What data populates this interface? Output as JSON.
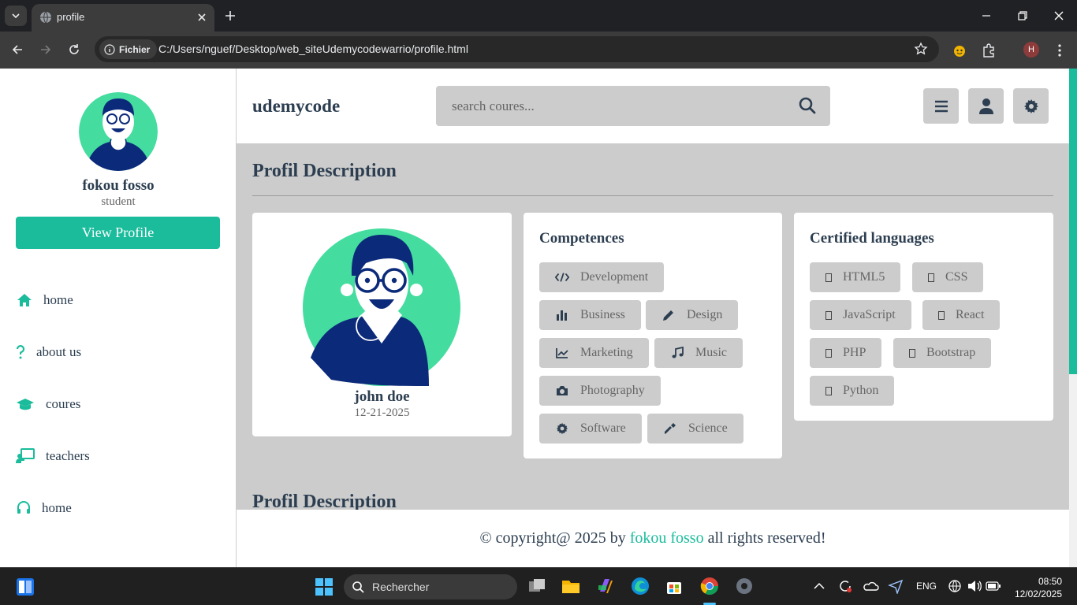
{
  "browser": {
    "tab_title": "profile",
    "security_chip": "Fichier",
    "url": "C:/Users/nguef/Desktop/web_siteUdemycodewarrio/profile.html",
    "profile_initial": "H"
  },
  "sidebar": {
    "user_name": "fokou fosso",
    "user_role": "student",
    "view_profile_label": "View Profile",
    "nav": [
      {
        "label": "home",
        "icon": "home-icon"
      },
      {
        "label": "about us",
        "icon": "question-icon"
      },
      {
        "label": "coures",
        "icon": "graduation-cap-icon"
      },
      {
        "label": "teachers",
        "icon": "chalkboard-teacher-icon"
      },
      {
        "label": "home",
        "icon": "headset-icon"
      }
    ]
  },
  "header": {
    "logo": "udemycode",
    "search_placeholder": "search coures..."
  },
  "main": {
    "heading": "Profil Description",
    "heading_repeat": "Profil Description",
    "profile_card": {
      "name": "john doe",
      "date": "12-21-2025"
    },
    "competences": {
      "title": "Competences",
      "items": [
        {
          "label": "Development",
          "icon": "code-icon"
        },
        {
          "label": "Business",
          "icon": "bar-chart-icon"
        },
        {
          "label": "Design",
          "icon": "pen-icon"
        },
        {
          "label": "Marketing",
          "icon": "line-chart-icon"
        },
        {
          "label": "Music",
          "icon": "music-icon"
        },
        {
          "label": "Photography",
          "icon": "camera-icon"
        },
        {
          "label": "Software",
          "icon": "cog-icon"
        },
        {
          "label": "Science",
          "icon": "eyedropper-icon"
        }
      ]
    },
    "languages": {
      "title": "Certified languages",
      "items": [
        "HTML5",
        "CSS",
        "JavaScript",
        "React",
        "PHP",
        "Bootstrap",
        "Python"
      ]
    }
  },
  "footer": {
    "prefix": "© copyright@ 2025 by",
    "author": "fokou fosso",
    "suffix": "all rights reserved!"
  },
  "taskbar": {
    "search_label": "Rechercher",
    "lang": "ENG",
    "time": "08:50",
    "date": "12/02/2025"
  },
  "colors": {
    "accent": "#1abc9c",
    "dark_text": "#2c3e50",
    "tag_bg": "#cccccc"
  }
}
